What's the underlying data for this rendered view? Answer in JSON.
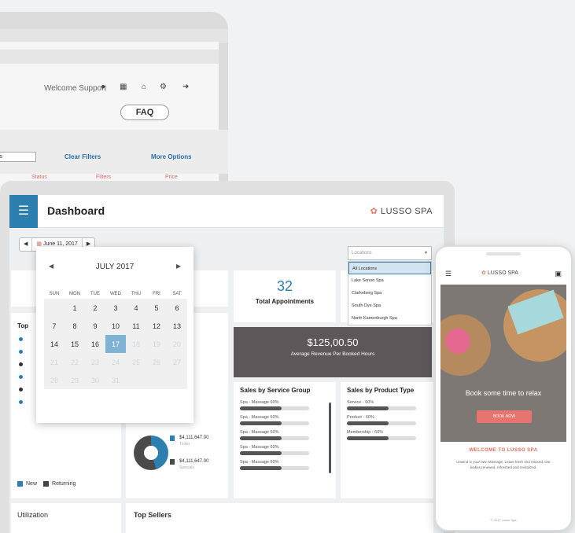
{
  "back_monitor": {
    "welcome": "Welcome Support",
    "faq": "FAQ",
    "filter_value": "Locations",
    "clear_filters": "Clear Filters",
    "more_options": "More Options",
    "tabs": [
      "Status",
      "Filters",
      "Price"
    ]
  },
  "dashboard": {
    "title": "Dashboard",
    "brand": "LUSSO SPA",
    "date_value": "June 11, 2017",
    "location_placeholder": "Locations",
    "location_options": [
      "All Locations",
      "Lake Sonoo Spa",
      "Clarkeberg Spa",
      "South Dye Spa",
      "North Kamenburgh Spa"
    ],
    "calendar": {
      "month": "JULY 2017",
      "weekdays": [
        "SUN",
        "MON",
        "TUE",
        "WED",
        "THU",
        "FRI",
        "SAT"
      ],
      "rows": [
        [
          "",
          "",
          "",
          "",
          "",
          "",
          ""
        ],
        [
          "",
          "1",
          "2",
          "3",
          "4",
          "5",
          "6"
        ],
        [
          "7",
          "8",
          "9",
          "10",
          "11",
          "12",
          "13"
        ],
        [
          "14",
          "15",
          "16",
          "17",
          "18",
          "19",
          "20"
        ],
        [
          "21",
          "22",
          "23",
          "24",
          "25",
          "26",
          "27"
        ],
        [
          "28",
          "29",
          "30",
          "31",
          "",
          "",
          ""
        ]
      ],
      "selected": "17"
    },
    "appointments": {
      "value": "32",
      "label": "Total Appointments"
    },
    "revenue": {
      "value": "$125,00.50",
      "label": "Average Revenue Per Booked Hours"
    },
    "top_label": "Top",
    "sales_service": {
      "title": "Sales by Service Group",
      "items": [
        {
          "label": "Spa - Massage 60%",
          "pct": 0.6
        },
        {
          "label": "Spa - Massage 60%",
          "pct": 0.6
        },
        {
          "label": "Spa - Massage 60%",
          "pct": 0.6
        },
        {
          "label": "Spa - Massage 60%",
          "pct": 0.6
        },
        {
          "label": "Spa - Massage 60%",
          "pct": 0.6
        }
      ]
    },
    "sales_product": {
      "title": "Sales by Product Type",
      "items": [
        {
          "label": "Service - 60%",
          "pct": 0.6
        },
        {
          "label": "Product - 60%",
          "pct": 0.6
        },
        {
          "label": "Membership - 60%",
          "pct": 0.6
        }
      ]
    },
    "donut": {
      "entries": [
        {
          "value": "$4,111,647.00",
          "sub": "Ticker",
          "color": "#2d7fb0"
        },
        {
          "value": "$4,111,647.00",
          "sub": "Specials",
          "color": "#4a4a4a"
        }
      ]
    },
    "legend": {
      "new": "New",
      "returning": "Returning"
    },
    "utilization": "Utilization",
    "top_sellers": "Top Sellers"
  },
  "phone": {
    "brand": "LUSSO SPA",
    "hero_text": "Book some time to relax",
    "hero_button": "BOOK NOW",
    "welcome": "WELCOME TO LUSSO SPA",
    "body": "Unwind in your own Massage. Leave fresh and relaxed. Our bodies renewed, refreshed and revitalized.",
    "footer": "© 2017 Lusso Spa"
  },
  "colors": {
    "accent": "#2d7fb0",
    "brand_coral": "#e0816c",
    "revenue_bg": "#5d5759"
  }
}
